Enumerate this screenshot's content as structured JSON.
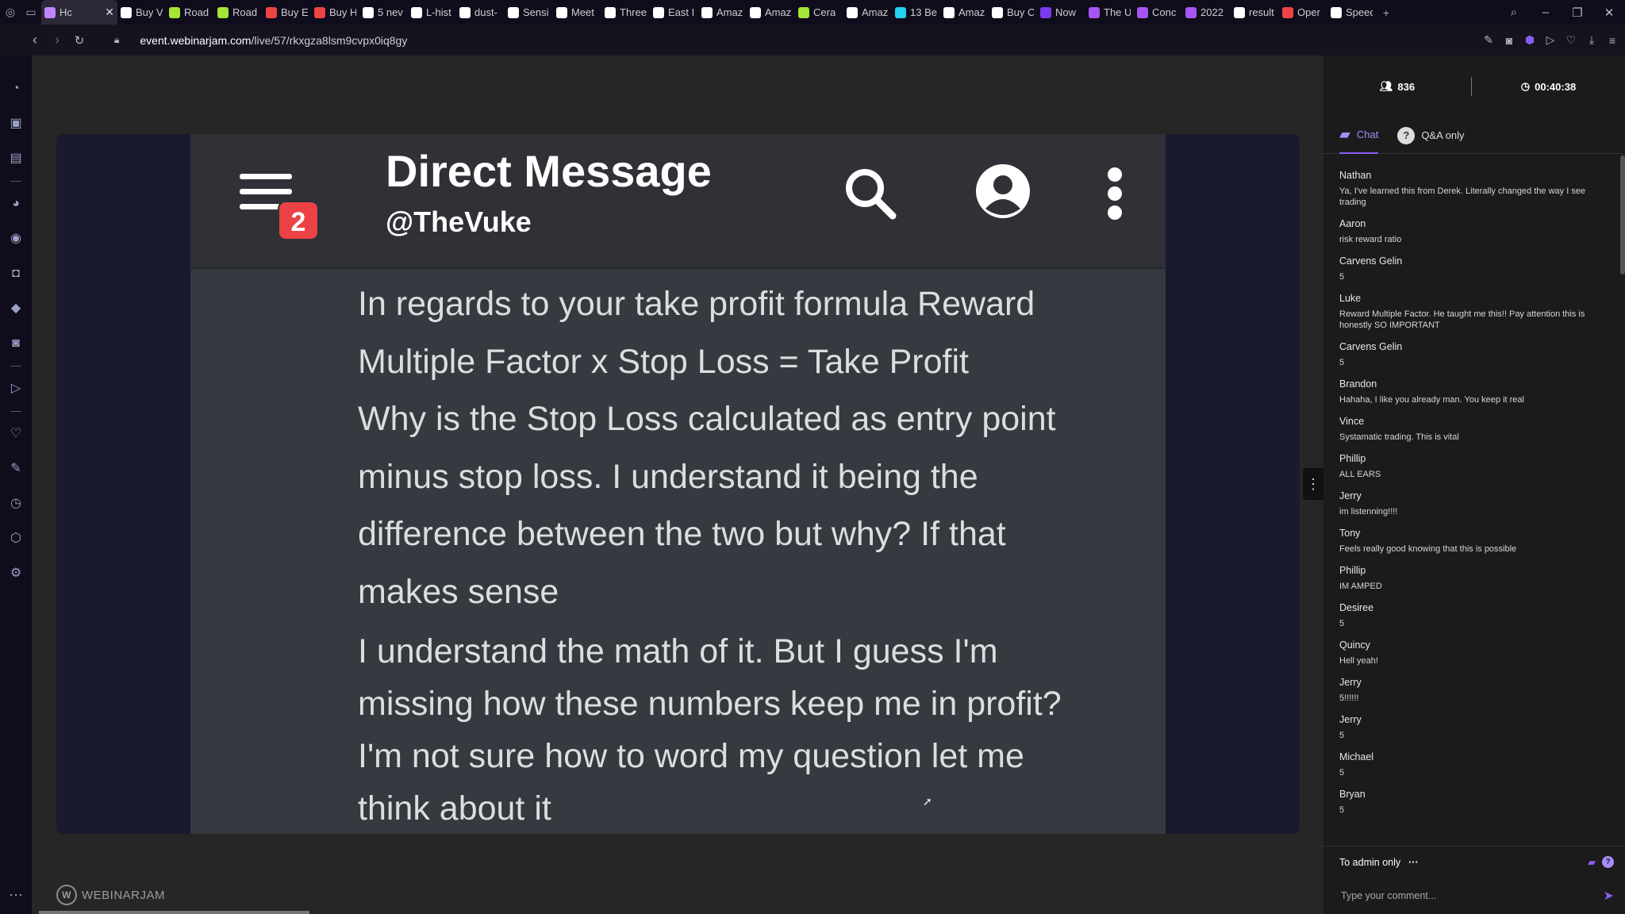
{
  "browser": {
    "tabs": [
      {
        "label": "Hc",
        "fav": "#c084fc",
        "active": true
      },
      {
        "label": "Buy V",
        "fav": "#ffffff"
      },
      {
        "label": "Road",
        "fav": "#a3e635"
      },
      {
        "label": "Road",
        "fav": "#a3e635"
      },
      {
        "label": "Buy E",
        "fav": "#ef4444"
      },
      {
        "label": "Buy H",
        "fav": "#ef4444"
      },
      {
        "label": "5 nev",
        "fav": "#ffffff"
      },
      {
        "label": "L-hist",
        "fav": "#ffffff"
      },
      {
        "label": "dust-",
        "fav": "#ffffff"
      },
      {
        "label": "Sensi",
        "fav": "#ffffff"
      },
      {
        "label": "Meet",
        "fav": "#ffffff"
      },
      {
        "label": "Three",
        "fav": "#ffffff"
      },
      {
        "label": "East I",
        "fav": "#ffffff"
      },
      {
        "label": "Amaz",
        "fav": "#ffffff"
      },
      {
        "label": "Amaz",
        "fav": "#ffffff"
      },
      {
        "label": "Cera",
        "fav": "#a3e635"
      },
      {
        "label": "Amaz",
        "fav": "#ffffff"
      },
      {
        "label": "13 Be",
        "fav": "#22d3ee"
      },
      {
        "label": "Amaz",
        "fav": "#ffffff"
      },
      {
        "label": "Buy C",
        "fav": "#ffffff"
      },
      {
        "label": "Now",
        "fav": "#7c3aed"
      },
      {
        "label": "The U",
        "fav": "#a855f7"
      },
      {
        "label": "Conc",
        "fav": "#a855f7"
      },
      {
        "label": "2022",
        "fav": "#a855f7"
      },
      {
        "label": "result",
        "fav": "#ffffff"
      },
      {
        "label": "Oper",
        "fav": "#ef4444"
      },
      {
        "label": "Speed",
        "fav": "#ffffff"
      }
    ],
    "url_domain": "event.webinarjam.com",
    "url_path": "/live/57/rkxgza8lsm9cvpx0iq8gy"
  },
  "video": {
    "dm_title": "Direct Message",
    "dm_handle": "@TheVuke",
    "badge_count": "2",
    "message_1": [
      "In regards to your take profit formula Reward",
      "Multiple Factor x Stop Loss = Take Profit",
      "Why is the Stop Loss calculated as entry point",
      "minus stop loss. I understand it being the",
      "difference between the two but why? If that",
      "makes sense"
    ],
    "message_2": [
      "I understand the math of it. But I guess I'm",
      "missing how these numbers keep me in profit?",
      "I'm not sure how to word my question let me",
      "think about it"
    ],
    "footer_brand": "WEBINARJAM"
  },
  "chat": {
    "viewers": "836",
    "elapsed": "00:40:38",
    "tab_chat": "Chat",
    "tab_qa": "Q&A only",
    "messages": [
      {
        "name": "Nathan",
        "text": "Ya, I've learned this from Derek. Literally changed the way I see trading"
      },
      {
        "name": "Aaron",
        "text": "risk reward ratio"
      },
      {
        "name": "Carvens Gelin",
        "text": "5"
      },
      {
        "name": "Luke",
        "text": "Reward Multiple Factor. He taught me this!! Pay attention this is honestly SO IMPORTANT"
      },
      {
        "name": "Carvens Gelin",
        "text": "5"
      },
      {
        "name": "Brandon",
        "text": "Hahaha, I like you already man. You keep it real"
      },
      {
        "name": "Vince",
        "text": "Systamatic trading. This is vital"
      },
      {
        "name": "Phillip",
        "text": "ALL EARS"
      },
      {
        "name": "Jerry",
        "text": "im listenning!!!!"
      },
      {
        "name": "Tony",
        "text": "Feels really good knowing that this is possible"
      },
      {
        "name": "Phillip",
        "text": "IM AMPED"
      },
      {
        "name": "Desiree",
        "text": "5"
      },
      {
        "name": "Quincy",
        "text": "Hell yeah!"
      },
      {
        "name": "Jerry",
        "text": "5!!!!!!"
      },
      {
        "name": "Jerry",
        "text": "5"
      },
      {
        "name": "Michael",
        "text": "5"
      },
      {
        "name": "Bryan",
        "text": "5"
      }
    ],
    "admin_label": "To admin only",
    "comment_placeholder": "Type your comment..."
  },
  "colors": {
    "accent": "#8b5cf6",
    "discord_red": "#ed4245",
    "discord_bg": "#36393f"
  }
}
